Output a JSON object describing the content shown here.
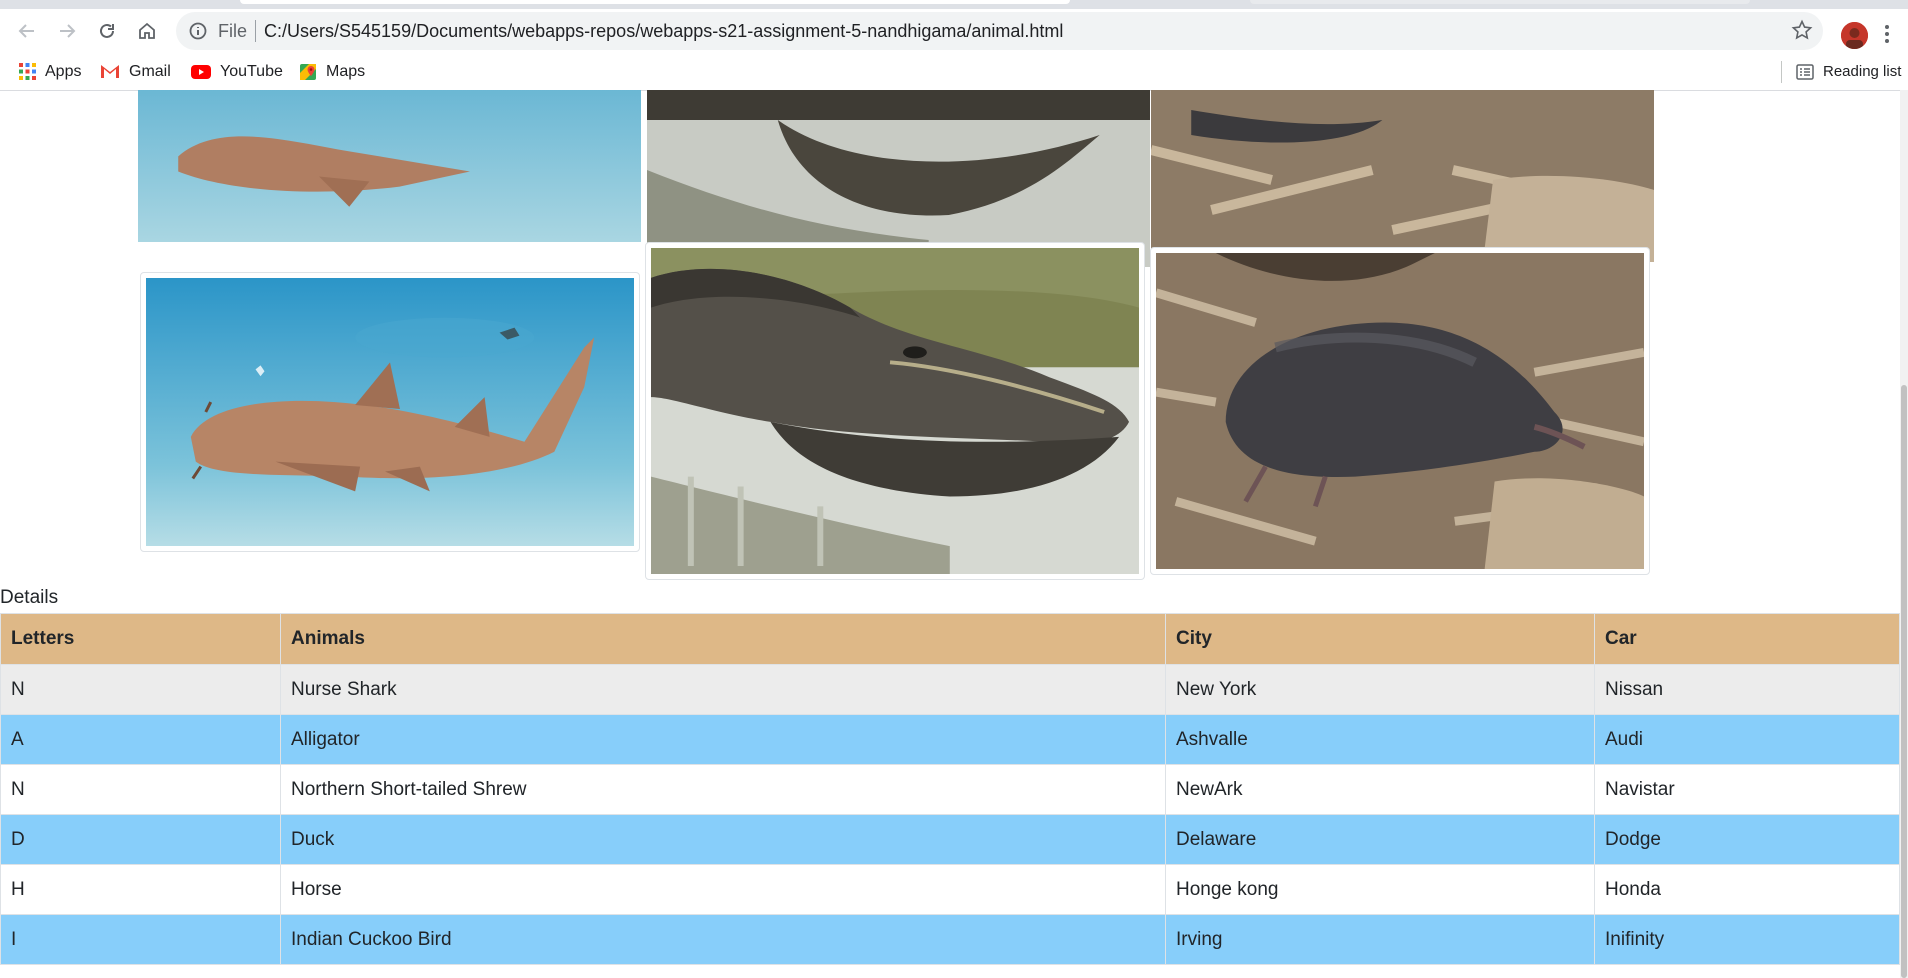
{
  "browser": {
    "file_label": "File",
    "url": "C:/Users/S545159/Documents/webapps-repos/webapps-s21-assignment-5-nandhigama/animal.html",
    "bookmarks": [
      "Apps",
      "Gmail",
      "YouTube",
      "Maps"
    ],
    "reading_list": "Reading list"
  },
  "icons": [
    "back-icon",
    "forward-icon",
    "reload-icon",
    "home-icon",
    "info-icon",
    "star-icon",
    "apps-icon",
    "gmail-icon",
    "youtube-icon",
    "maps-icon",
    "reading-list-icon",
    "profile-avatar",
    "kebab-menu-icon"
  ],
  "images": {
    "shark": "nurse shark photo",
    "alligator": "alligator photo",
    "shrew": "shrew photo"
  },
  "details_label": "Details",
  "table": {
    "headers": [
      "Letters",
      "Animals",
      "City",
      "Car"
    ],
    "rows": [
      [
        "N",
        "Nurse Shark",
        "New York",
        "Nissan"
      ],
      [
        "A",
        "Alligator",
        "Ashvalle",
        "Audi"
      ],
      [
        "N",
        "Northern Short-tailed Shrew",
        "NewArk",
        "Navistar"
      ],
      [
        "D",
        "Duck",
        "Delaware",
        "Dodge"
      ],
      [
        "H",
        "Horse",
        "Honge kong",
        "Honda"
      ],
      [
        "I",
        "Indian Cuckoo Bird",
        "Irving",
        "Inifinity"
      ]
    ]
  },
  "colors": {
    "header_bg": "#deb887",
    "row_blue": "#87cefa",
    "row_gray": "#ececec"
  }
}
